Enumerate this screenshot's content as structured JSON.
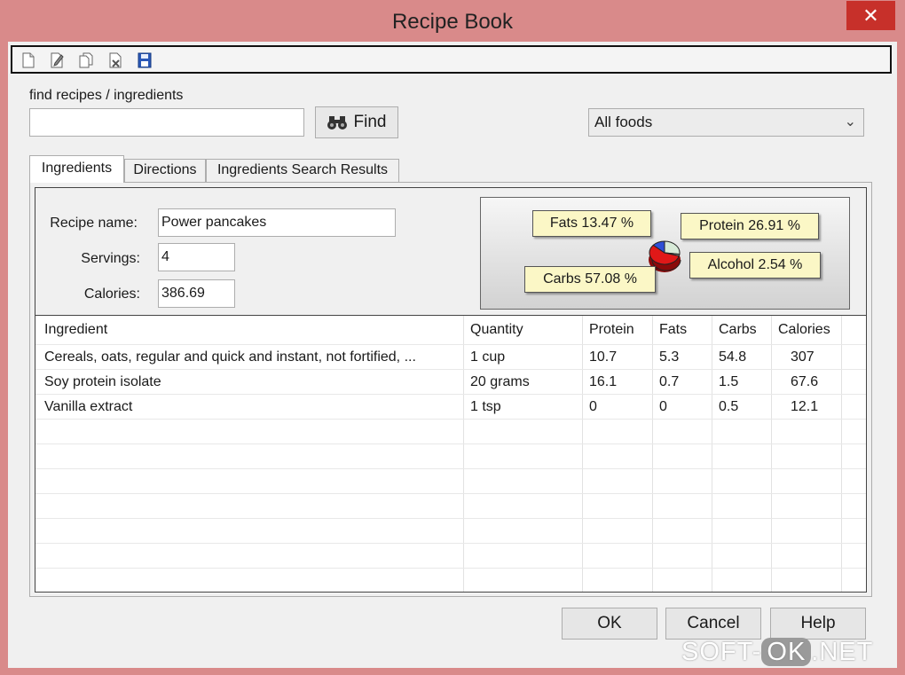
{
  "window": {
    "title": "Recipe Book",
    "close_symbol": "✕"
  },
  "toolbar": {
    "icons": [
      "new-document-icon",
      "edit-document-icon",
      "copy-document-icon",
      "delete-document-icon",
      "save-disk-icon"
    ]
  },
  "search": {
    "label": "find recipes / ingredients",
    "value": "",
    "find_label": "Find"
  },
  "food_filter": {
    "selected": "All foods"
  },
  "tabs": [
    {
      "label": "Ingredients",
      "active": true
    },
    {
      "label": "Directions",
      "active": false
    },
    {
      "label": "Ingredients Search Results",
      "active": false
    }
  ],
  "recipe": {
    "name_label": "Recipe name:",
    "name": "Power pancakes",
    "servings_label": "Servings:",
    "servings": "4",
    "calories_label": "Calories:",
    "calories": "386.69"
  },
  "chart_data": {
    "type": "pie",
    "title": "",
    "slices": [
      {
        "name": "Fats",
        "value": 13.47,
        "label": "Fats 13.47 %",
        "color": "#2f4fd6"
      },
      {
        "name": "Protein",
        "value": 26.91,
        "label": "Protein 26.91 %",
        "color": "#d8ead8"
      },
      {
        "name": "Alcohol",
        "value": 2.54,
        "label": "Alcohol 2.54 %",
        "color": "#999999"
      },
      {
        "name": "Carbs",
        "value": 57.08,
        "label": "Carbs 57.08 %",
        "color": "#e01818"
      }
    ]
  },
  "table": {
    "columns": [
      "Ingredient",
      "Quantity",
      "Protein",
      "Fats",
      "Carbs",
      "Calories"
    ],
    "rows": [
      [
        "Cereals, oats, regular and quick and instant, not fortified, ...",
        "1 cup",
        "10.7",
        "5.3",
        "54.8",
        "307"
      ],
      [
        "Soy protein isolate",
        "20 grams",
        "16.1",
        "0.7",
        "1.5",
        "67.6"
      ],
      [
        "Vanilla extract",
        "1 tsp",
        "0",
        "0",
        "0.5",
        "12.1"
      ]
    ]
  },
  "buttons": {
    "ok": "OK",
    "cancel": "Cancel",
    "help": "Help"
  },
  "watermark": {
    "left": "SOFT-",
    "mid": "OK",
    "right": ".NET"
  }
}
